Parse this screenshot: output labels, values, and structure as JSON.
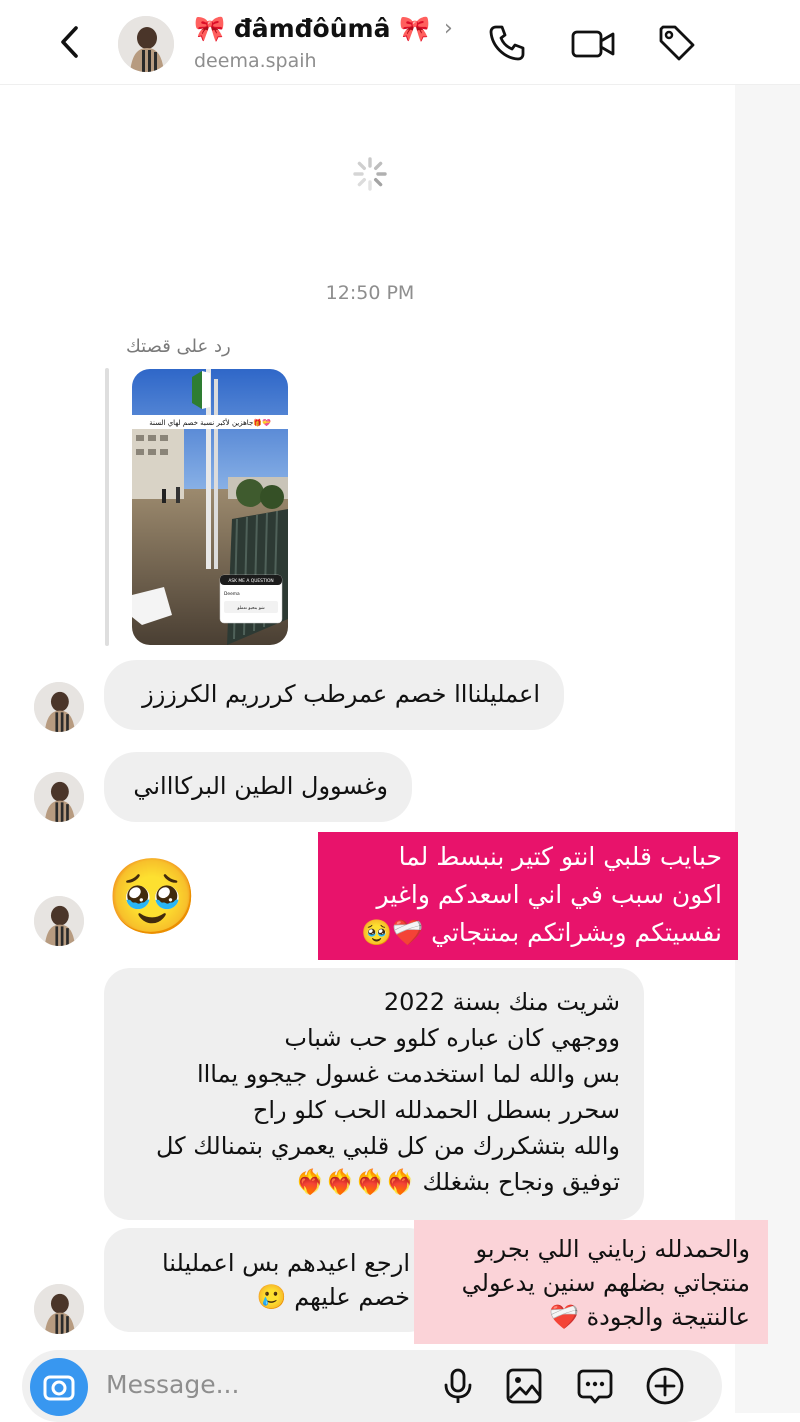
{
  "header": {
    "display_name": "🎀 đâmđôûmâ 🎀",
    "username": "deema.spaih",
    "chevron": "›"
  },
  "thread": {
    "timestamp": "12:50 PM",
    "reply_label": "رد على قصتك",
    "story": {
      "banner_text": "جاهزين لأكبر نسبة خصم لهاي السنة🎁💝",
      "sticker_title": "ASK ME A QUESTION",
      "sticker_name": "Deema",
      "sticker_answer": "شو بتحبو تعملو"
    },
    "messages": [
      {
        "side": "left",
        "lines": [
          "اعمليلنااا خصم عمرطب كررريم الكرززز"
        ]
      },
      {
        "side": "left",
        "lines": [
          "وغسوول الطين البركاااني"
        ]
      },
      {
        "side": "left",
        "emoji": "🥹"
      },
      {
        "side": "right",
        "overlay": "pink",
        "lines": [
          "حبايب قلبي انتو كتير بنبسط لما",
          "اكون سبب في اني اسعدكم واغير",
          "نفسيتكم وبشراتكم بمنتجاتي ❤️‍🩹🥹"
        ]
      },
      {
        "side": "left",
        "lines": [
          "شريت منك بسنة 2022",
          "ووجهي كان عباره كلوو حب شباب",
          "بس والله لما استخدمت غسول جيجوو يمااا",
          "سحرر بسطل الحمدلله الحب كلو راح",
          "والله بتشكررك من كل قلبي يعمري بتمنالك كل",
          "توفيق ونجاح بشغلك ❤️‍🔥❤️‍🔥❤️‍🔥❤️‍🔥"
        ]
      },
      {
        "side": "left",
        "lines": [
          "ارجع اعيدهم بس اعمليلنا",
          "خصم عليهم 🥲"
        ]
      },
      {
        "side": "right",
        "overlay": "lightpink",
        "lines": [
          "والحمدلله زبايني اللي بجربو",
          "منتجاتي بضلهم سنين يدعولي",
          "عالنتيجة والجودة ❤️‍🩹"
        ]
      }
    ]
  },
  "composer": {
    "placeholder": "Message..."
  },
  "icons": {
    "back": "chevron-left-icon",
    "call": "phone-icon",
    "video": "video-camera-icon",
    "tag": "tag-icon",
    "camera": "camera-icon",
    "mic": "microphone-icon",
    "gallery": "image-icon",
    "sticker": "sticker-chat-icon",
    "add": "plus-circle-icon"
  },
  "colors": {
    "pink_overlay": "#e8136b",
    "lightpink_overlay": "#fbd3d8",
    "camera_button": "#3897f0",
    "bubble": "#efefef"
  }
}
